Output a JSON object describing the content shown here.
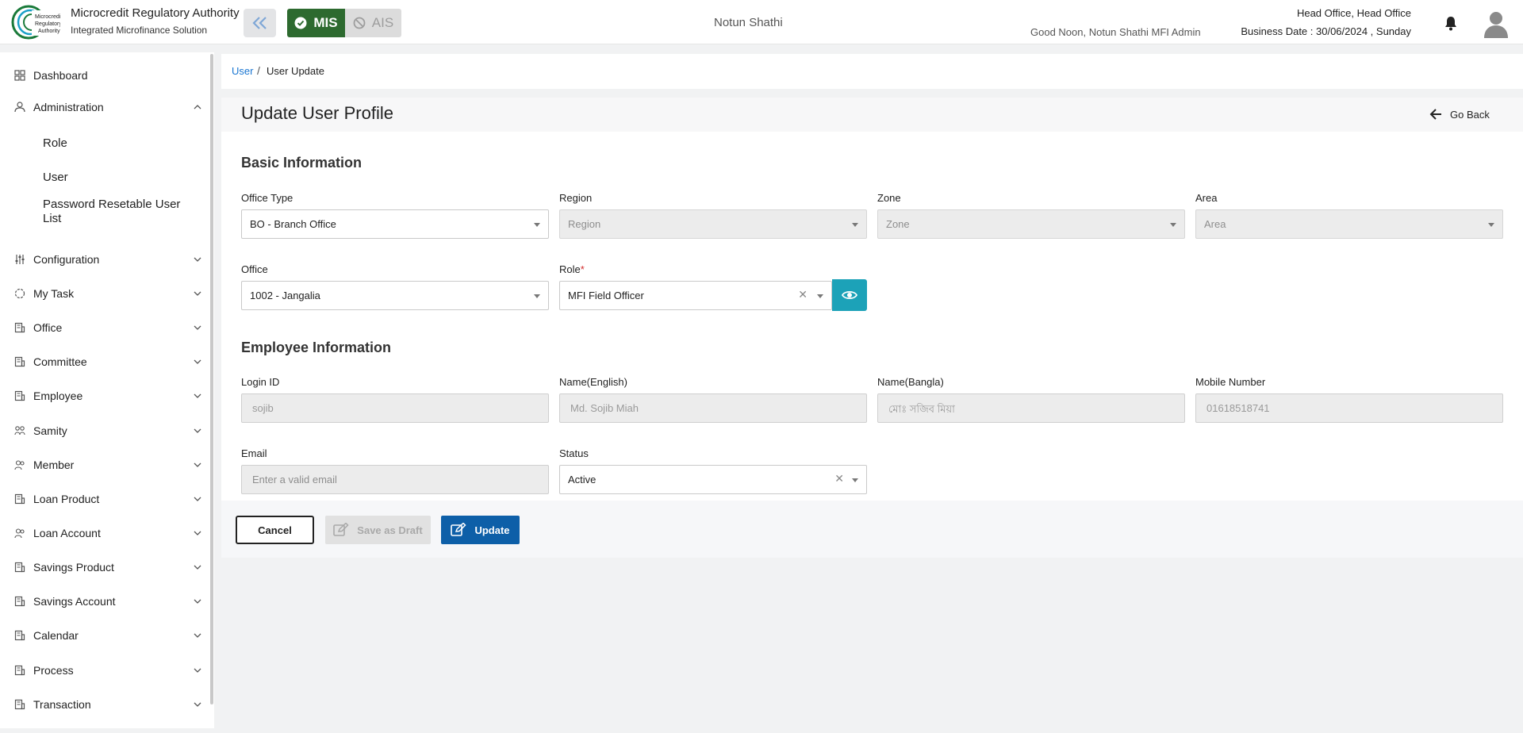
{
  "header": {
    "brand_title": "Microcredit Regulatory Authority",
    "brand_subtitle": "Integrated Microfinance Solution",
    "logo_text": [
      "Microcredit",
      "Regulatory",
      "Authority"
    ],
    "modes": {
      "mis": "MIS",
      "ais": "AIS"
    },
    "tenant_name": "Notun Shathi",
    "greeting": "Good Noon, Notun Shathi MFI Admin",
    "office": "Head Office, Head Office",
    "business_date": "Business Date : 30/06/2024 , Sunday"
  },
  "sidebar": {
    "dashboard": "Dashboard",
    "administration": "Administration",
    "sub_items": [
      "Role",
      "User",
      "Password Resetable User List"
    ],
    "items": [
      "Configuration",
      "My Task",
      "Office",
      "Committee",
      "Employee",
      "Samity",
      "Member",
      "Loan Product",
      "Loan Account",
      "Savings Product",
      "Savings Account",
      "Calendar",
      "Process",
      "Transaction"
    ]
  },
  "breadcrumb": {
    "parent": "User",
    "separator": "/",
    "current": "User Update"
  },
  "page": {
    "title": "Update User Profile",
    "go_back": "Go Back"
  },
  "basic_info": {
    "title": "Basic Information",
    "office_type": {
      "label": "Office Type",
      "value": "BO - Branch Office"
    },
    "region": {
      "label": "Region",
      "placeholder": "Region"
    },
    "zone": {
      "label": "Zone",
      "placeholder": "Zone"
    },
    "area": {
      "label": "Area",
      "placeholder": "Area"
    },
    "office": {
      "label": "Office",
      "value": "1002 - Jangalia"
    },
    "role": {
      "label": "Role",
      "required_mark": "*",
      "value": "MFI Field Officer"
    }
  },
  "employee_info": {
    "title": "Employee Information",
    "login_id": {
      "label": "Login ID",
      "value": "sojib"
    },
    "name_english": {
      "label": "Name(English)",
      "value": "Md. Sojib Miah"
    },
    "name_bangla": {
      "label": "Name(Bangla)",
      "value": "মোঃ সজিব মিয়া"
    },
    "mobile": {
      "label": "Mobile Number",
      "value": "01618518741"
    },
    "email": {
      "label": "Email",
      "placeholder": "Enter a valid email"
    },
    "status": {
      "label": "Status",
      "value": "Active"
    }
  },
  "actions": {
    "cancel": "Cancel",
    "save_draft": "Save as Draft",
    "update": "Update"
  },
  "colors": {
    "mis_active": "#2d6a2f",
    "link": "#1976d2",
    "eye_button": "#1ca2b8",
    "update_button": "#0d5fa8",
    "required": "#d32f2f"
  }
}
